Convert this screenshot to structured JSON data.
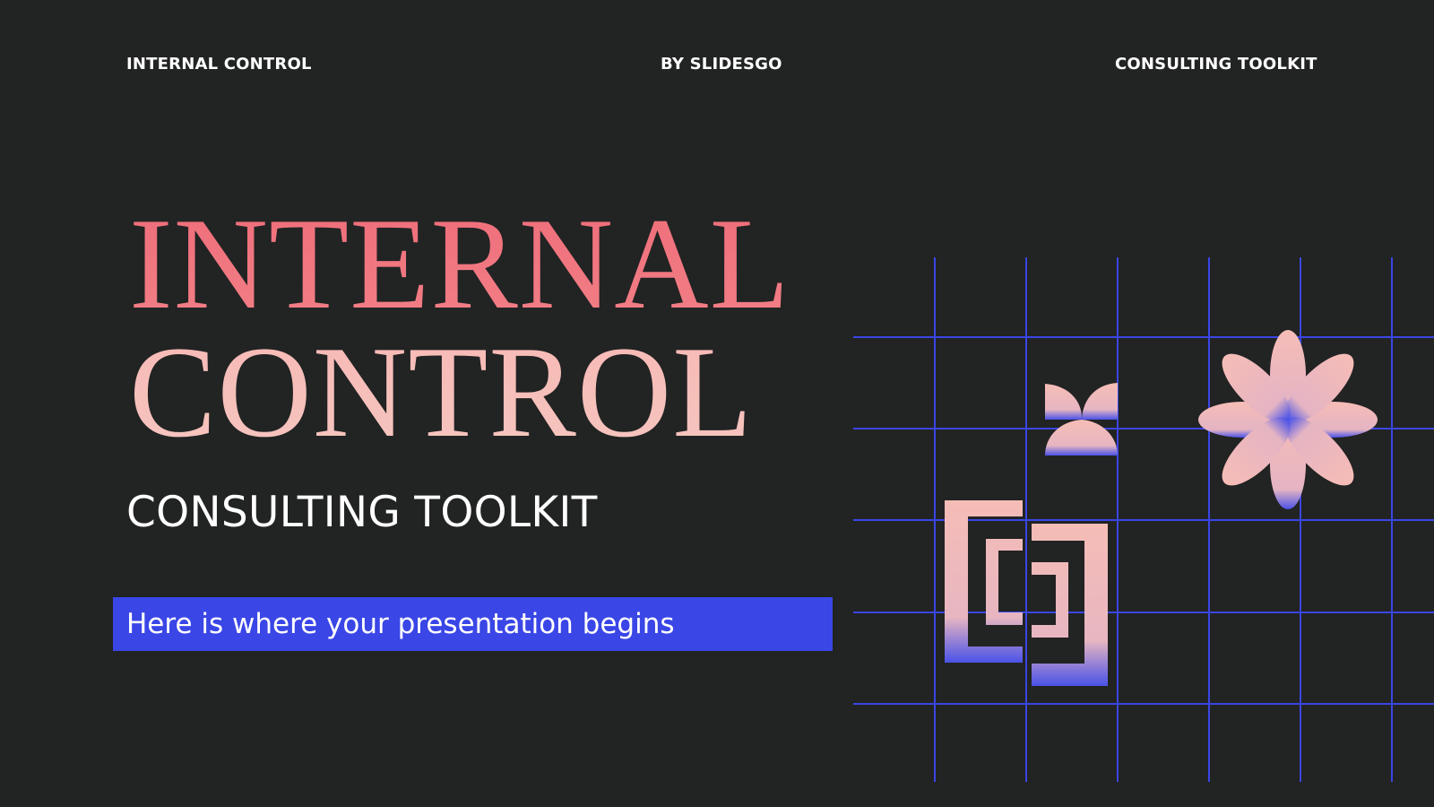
{
  "header": {
    "left_label": "INTERNAL CONTROL",
    "center_label": "BY SLIDESGO",
    "right_label": "CONSULTING TOOLKIT"
  },
  "title": {
    "line1": "INTERNAL",
    "line2": "CONTROL"
  },
  "subtitle": "CONSULTING TOOLKIT",
  "tagline": "Here is where your presentation begins",
  "colors": {
    "background": "#222323",
    "title_primary": "#ee6d7a",
    "title_secondary": "#f6c0ba",
    "accent_blue": "#3a46e6",
    "grid_line": "#3a46e6",
    "shape_pink": "#f6bdb6",
    "shape_blue": "#4a52e8"
  },
  "decorations": {
    "grid": "blue-line-grid",
    "shapes": [
      "bracket-shape",
      "pinwheel-shape",
      "flower-shape"
    ]
  }
}
